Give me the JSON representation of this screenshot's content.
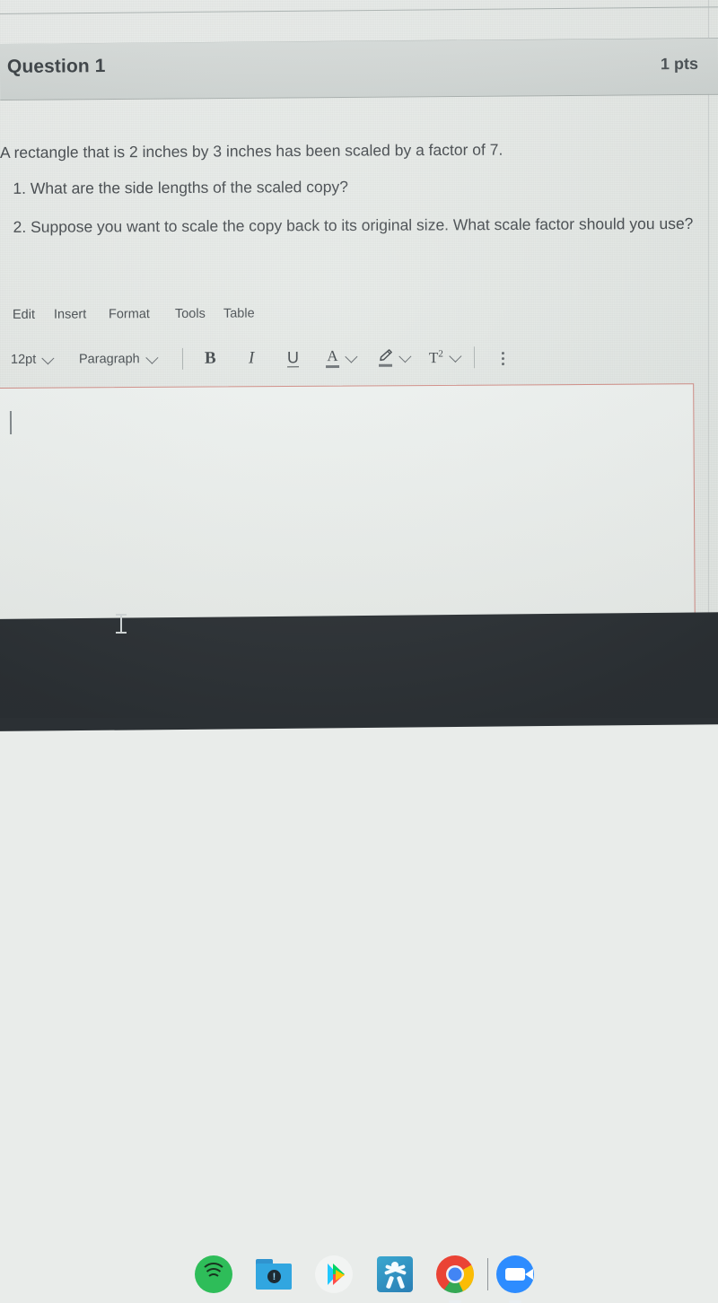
{
  "question": {
    "title": "Question 1",
    "points": "1 pts",
    "stem": "A rectangle that is 2 inches by 3 inches has been scaled by a factor of 7.",
    "items": [
      "What are the side lengths of the scaled copy?",
      "Suppose you want to scale the copy back to its original size. What scale factor should you use?"
    ]
  },
  "editor": {
    "menubar": [
      {
        "label": "Edit",
        "name": "menu-edit"
      },
      {
        "label": "Insert",
        "name": "menu-insert"
      },
      {
        "label": "Format",
        "name": "menu-format"
      },
      {
        "label": "Tools",
        "name": "menu-tools"
      },
      {
        "label": "Table",
        "name": "menu-table"
      }
    ],
    "toolbar": {
      "font_size": "12pt",
      "block_format": "Paragraph",
      "bold": "B",
      "italic": "I",
      "underline": "U",
      "text_color": "A",
      "highlight": "highlighter",
      "superscript": "T",
      "superscript_exp": "2",
      "more": "more-options"
    },
    "body_text": "",
    "border_color": "#d08b84"
  },
  "taskbar": {
    "background": "#2b3034",
    "apps": [
      {
        "name": "spotify",
        "label": "Spotify",
        "color": "#2ebd59",
        "running": false
      },
      {
        "name": "files",
        "label": "Files",
        "color": "#31a6e0",
        "running": false
      },
      {
        "name": "play-store",
        "label": "Play Store",
        "color": "#f2f4f3",
        "running": false
      },
      {
        "name": "xtramath",
        "label": "X App",
        "color": "#2a7fb5",
        "running": false
      },
      {
        "name": "chrome",
        "label": "Chrome",
        "color": "#4285f4",
        "running": true
      },
      {
        "name": "zoom",
        "label": "Zoom",
        "color": "#2d8cff",
        "running": true
      }
    ]
  },
  "cursor": {
    "type": "text-ibeam"
  }
}
